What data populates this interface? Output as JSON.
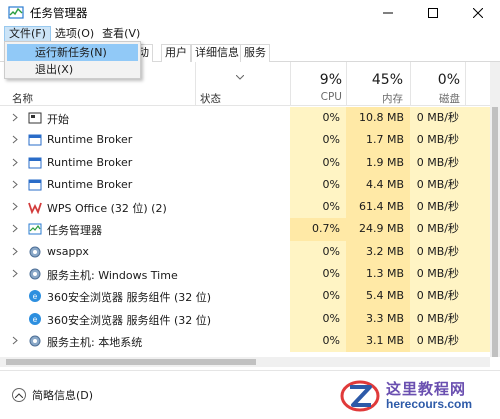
{
  "window": {
    "title": "任务管理器",
    "controls": {
      "minimize": "minimize-icon",
      "maximize": "maximize-icon",
      "close": "close-icon"
    }
  },
  "menubar": {
    "items": [
      "文件(F)",
      "选项(O)",
      "查看(V)"
    ]
  },
  "dropdown": {
    "items": [
      "运行新任务(N)",
      "退出(X)"
    ]
  },
  "tabs": {
    "items": [
      "动",
      "用户",
      "详细信息",
      "服务"
    ]
  },
  "columns": {
    "name": "名称",
    "status": "状态",
    "cpu": {
      "pct": "9%",
      "label": "CPU"
    },
    "memory": {
      "pct": "45%",
      "label": "内存"
    },
    "disk": {
      "pct": "0%",
      "label": "磁盘"
    }
  },
  "rows": [
    {
      "name": "开始",
      "icon": "start-app-icon",
      "cpu": "0%",
      "memory": "10.8 MB",
      "disk": "0 MB/秒"
    },
    {
      "name": "Runtime Broker",
      "icon": "process-icon",
      "cpu": "0%",
      "memory": "1.7 MB",
      "disk": "0 MB/秒"
    },
    {
      "name": "Runtime Broker",
      "icon": "process-icon",
      "cpu": "0%",
      "memory": "1.9 MB",
      "disk": "0 MB/秒"
    },
    {
      "name": "Runtime Broker",
      "icon": "process-icon",
      "cpu": "0%",
      "memory": "4.4 MB",
      "disk": "0 MB/秒"
    },
    {
      "name": "WPS Office (32 位) (2)",
      "icon": "wps-office-icon",
      "cpu": "0%",
      "memory": "61.4 MB",
      "disk": "0 MB/秒"
    },
    {
      "name": "任务管理器",
      "icon": "task-manager-icon",
      "cpu": "0.7%",
      "memory": "24.9 MB",
      "disk": "0 MB/秒"
    },
    {
      "name": "wsappx",
      "icon": "gear-icon",
      "cpu": "0%",
      "memory": "3.2 MB",
      "disk": "0 MB/秒"
    },
    {
      "name": "服务主机: Windows Time",
      "icon": "gear-icon",
      "cpu": "0%",
      "memory": "1.3 MB",
      "disk": "0 MB/秒"
    },
    {
      "name": "360安全浏览器 服务组件 (32 位)",
      "icon": "360-browser-icon",
      "cpu": "0%",
      "memory": "5.4 MB",
      "disk": "0 MB/秒"
    },
    {
      "name": "360安全浏览器 服务组件 (32 位)",
      "icon": "360-browser-icon",
      "cpu": "0%",
      "memory": "3.3 MB",
      "disk": "0 MB/秒"
    },
    {
      "name": "服务主机: 本地系统",
      "icon": "gear-icon",
      "cpu": "0%",
      "memory": "3.1 MB",
      "disk": "0 MB/秒"
    }
  ],
  "footer": {
    "fewer_details": "简略信息(D)"
  },
  "watermark": {
    "cn": "这里教程网",
    "url": "herecours.com"
  },
  "colors": {
    "cpu_bg": "#fff4c4",
    "mem_bg": "#ffe9a6",
    "menu_highlight": "#91c9f7"
  }
}
